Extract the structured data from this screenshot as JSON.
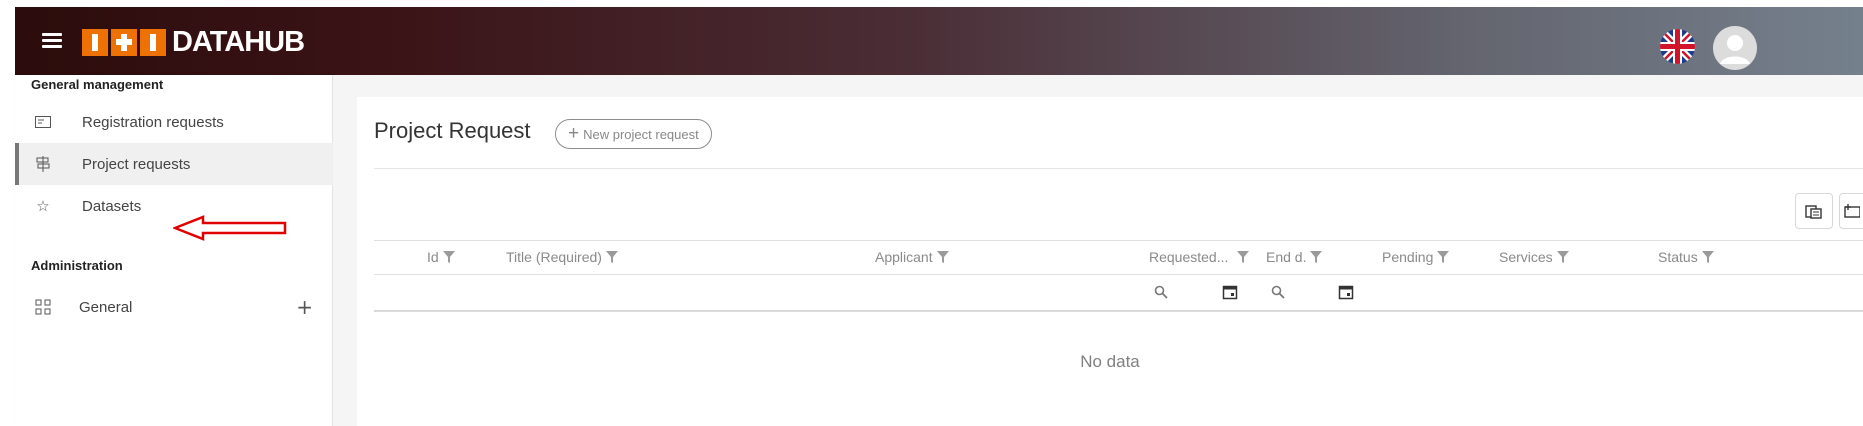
{
  "header": {
    "logo_text": "DATAHUB"
  },
  "sidebar": {
    "sections": [
      {
        "title": "General management"
      },
      {
        "title": "Administration"
      }
    ],
    "items": [
      {
        "label": "Registration requests",
        "icon": "id-card-icon"
      },
      {
        "label": "Project requests",
        "icon": "signpost-icon",
        "active": true
      },
      {
        "label": "Datasets",
        "icon": "star-icon"
      },
      {
        "label": "General",
        "icon": "grid-icon",
        "expandable": true
      }
    ]
  },
  "main": {
    "title": "Project Request",
    "new_button_label": "New project request",
    "columns": [
      {
        "label": "Id"
      },
      {
        "label": "Title (Required)"
      },
      {
        "label": "Applicant"
      },
      {
        "label": "Requested..."
      },
      {
        "label": "End d."
      },
      {
        "label": "Pending"
      },
      {
        "label": "Services"
      },
      {
        "label": "Status"
      }
    ],
    "empty_text": "No data"
  },
  "colors": {
    "accent_orange": "#ee7203",
    "header_dark": "#2c0c0c",
    "header_light": "#75808d",
    "annotation_red": "#e00000"
  }
}
